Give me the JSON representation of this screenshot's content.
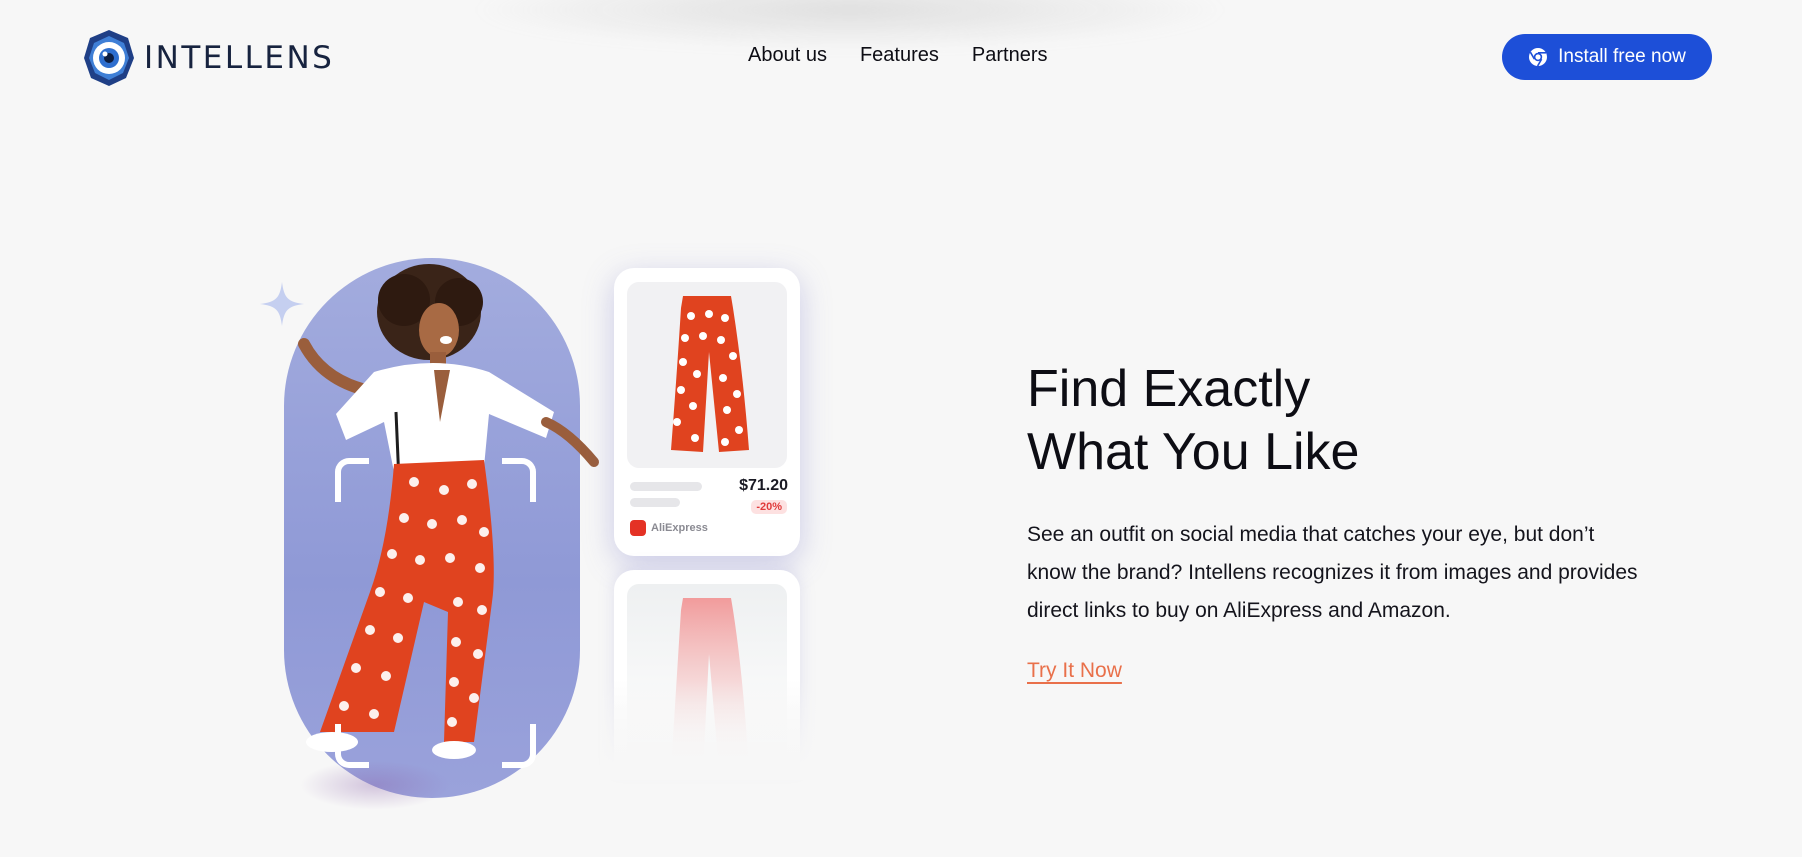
{
  "header": {
    "logo_text": "INTELLENS",
    "nav": [
      "About us",
      "Features",
      "Partners"
    ],
    "install_label": "Install free now"
  },
  "hero": {
    "title_line1": "Find Exactly",
    "title_line2": "What You Like",
    "description": "See an outfit on social media that catches your eye, but don’t know the brand? Intellens recognizes it from images and provides direct links to buy on AliExpress and Amazon.",
    "cta_label": "Try It Now"
  },
  "product_card": {
    "price": "$71.20",
    "discount": "-20%",
    "store_name": "AliExpress"
  },
  "colors": {
    "background": "#f7f7f7",
    "primary_button": "#1d4fd8",
    "cta_link": "#e9704a",
    "capsule": "#98a1da",
    "discount": "#e03b3b"
  },
  "icons": [
    "intellens-logo-icon",
    "chrome-icon",
    "sparkle-icon",
    "aliexpress-icon"
  ]
}
